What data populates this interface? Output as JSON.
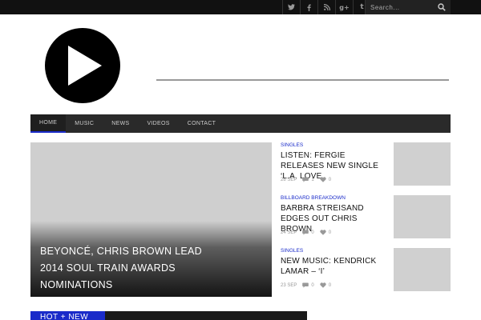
{
  "topbar": {
    "social": [
      {
        "name": "twitter-icon",
        "glyph": "𝕣"
      },
      {
        "name": "facebook-icon",
        "glyph": "f"
      },
      {
        "name": "rss-icon",
        "glyph": "◔"
      },
      {
        "name": "google-plus-icon",
        "glyph": "g+"
      },
      {
        "name": "tumblr-icon",
        "glyph": "t"
      }
    ],
    "search_placeholder": "Search..."
  },
  "nav": {
    "items": [
      "HOME",
      "MUSIC",
      "NEWS",
      "VIDEOS",
      "CONTACT"
    ],
    "active": "HOME",
    "accent": "#1a2bc9"
  },
  "featured": {
    "title": "BEYONCÉ, CHRIS BROWN LEAD 2014 SOUL TRAIN AWARDS NOMINATIONS"
  },
  "posts": [
    {
      "category": "SINGLES",
      "title": "LISTEN: FERGIE RELEASES NEW SINGLE ‘L.A. LOVE",
      "date": "28 SEP",
      "comments": "1",
      "likes": "0"
    },
    {
      "category": "BILLBOARD BREAKDOWN",
      "title": "BARBRA STREISAND EDGES OUT CHRIS BROWN",
      "date": "24 SEP",
      "comments": "0",
      "likes": "0"
    },
    {
      "category": "SINGLES",
      "title": "NEW MUSIC: KENDRICK LAMAR – ‘I’",
      "date": "23 SEP",
      "comments": "0",
      "likes": "0"
    }
  ],
  "hot": {
    "label": "HOT + NEW"
  }
}
